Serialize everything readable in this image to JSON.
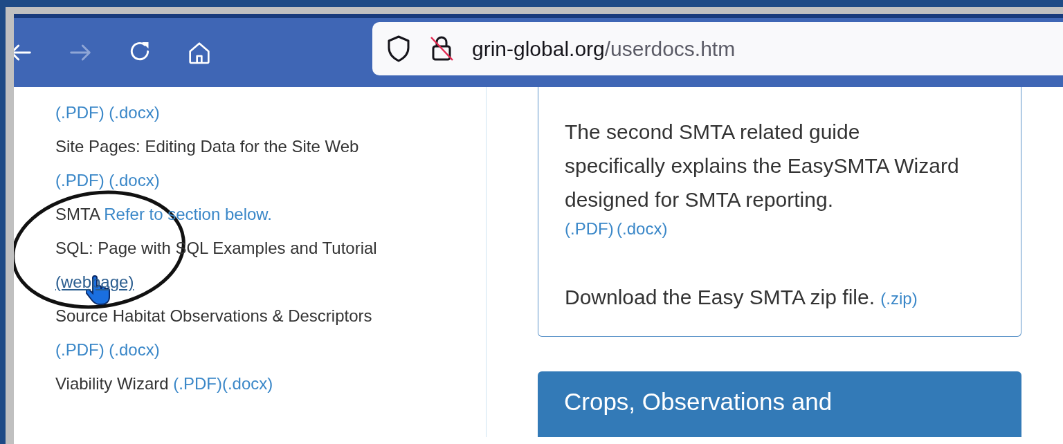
{
  "toolbar": {
    "buttons": [
      {
        "kind": "back",
        "disabled": false
      },
      {
        "kind": "forward",
        "disabled": true
      },
      {
        "kind": "reload",
        "disabled": false
      },
      {
        "kind": "home",
        "disabled": false
      }
    ],
    "address": {
      "domain": "grin-global.org",
      "path": "/userdocs.htm"
    }
  },
  "guide_list": [
    [
      {
        "kind": "link",
        "text": "(.PDF)",
        "hovered": false
      },
      {
        "kind": "link",
        "text": "(.docx)",
        "hovered": false
      }
    ],
    [
      {
        "kind": "text",
        "text": "Site Pages: Editing Data for the Site Web"
      }
    ],
    [
      {
        "kind": "link",
        "text": "(.PDF)",
        "hovered": false
      },
      {
        "kind": "link",
        "text": "(.docx)",
        "hovered": false
      }
    ],
    [
      {
        "kind": "text",
        "text": "SMTA"
      },
      {
        "kind": "link",
        "text": "Refer to section below.",
        "hovered": false
      }
    ],
    [
      {
        "kind": "text",
        "text": "SQL: Page with SQL Examples and Tutorial"
      }
    ],
    [
      {
        "kind": "link",
        "text": "(webpage)",
        "hovered": true
      }
    ],
    [
      {
        "kind": "text",
        "text": "Source Habitat Observations & Descriptors"
      }
    ],
    [
      {
        "kind": "link",
        "text": "(.PDF)",
        "hovered": false
      },
      {
        "kind": "link",
        "text": "(.docx)",
        "hovered": false
      }
    ],
    [
      {
        "kind": "text",
        "text": "Viability Wizard"
      },
      {
        "kind": "link",
        "text": "(.PDF)",
        "hovered": false
      },
      {
        "kind": "link",
        "text": "(.docx)",
        "hovered": false,
        "attached": true
      }
    ]
  ],
  "smta_card": {
    "description": "The second SMTA related guide specifically explains the EasySMTA Wizard designed for SMTA reporting.",
    "links": [
      "(.PDF)",
      "(.docx)"
    ],
    "download": {
      "text": "Download the Easy SMTA zip file.",
      "link": "(.zip)"
    }
  },
  "next_section": {
    "title": "Crops, Observations and"
  }
}
